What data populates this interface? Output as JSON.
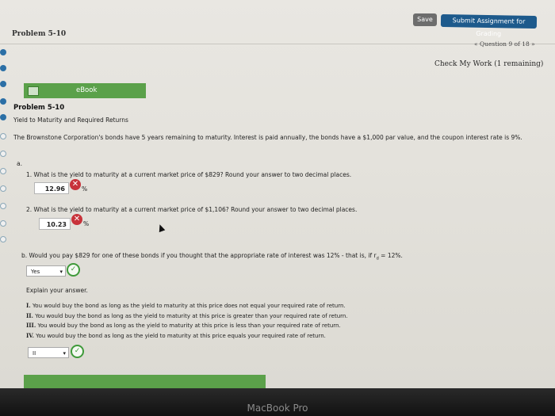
{
  "toolbar": {
    "save_label": "Save",
    "submit_label": "Submit Assignment for Grading"
  },
  "header": {
    "problem_label": "Problem 5-10",
    "question_nav": "« Question 9 of 18 »",
    "check_work": "Check My Work (1 remaining)"
  },
  "ebook": {
    "label": "eBook",
    "icon": "book-icon"
  },
  "problem": {
    "title": "Problem 5-10",
    "subtitle": "Yield to Maturity and Required Returns",
    "intro": "The Brownstone Corporation's bonds have 5 years remaining to maturity. Interest is paid annually, the bonds have a $1,000 par value, and the coupon interest rate is 9%."
  },
  "part_a": {
    "label": "a.",
    "q1": {
      "text": "1. What is the yield to maturity at a current market price of $829? Round your answer to two decimal places.",
      "answer": "12.96",
      "unit": "%",
      "status_icon": "x-circle-icon"
    },
    "q2": {
      "text": "2. What is the yield to maturity at a current market price of $1,106? Round your answer to two decimal places.",
      "answer": "10.23",
      "unit": "%",
      "status_icon": "x-circle-icon"
    }
  },
  "part_b": {
    "text": "b. Would you pay $829 for one of these bonds if you thought that the appropriate rate of interest was 12% - that is, if r",
    "subscript": "d",
    "text_end": " = 12%.",
    "select_value": "Yes",
    "explain_label": "Explain your answer.",
    "options": [
      {
        "num": "I.",
        "text": "You would buy the bond as long as the yield to maturity at this price does not equal your required rate of return."
      },
      {
        "num": "II.",
        "text": "You would buy the bond as long as the yield to maturity at this price is greater than your required rate of return."
      },
      {
        "num": "III.",
        "text": "You would buy the bond as long as the yield to maturity at this price is less than your required rate of return."
      },
      {
        "num": "IV.",
        "text": "You would buy the bond as long as the yield to maturity at this price equals your required rate of return."
      }
    ],
    "explain_select_value": "II"
  },
  "footer": {
    "brand": "MacBook Pro"
  },
  "colors": {
    "submit": "#1d5a8c",
    "ebook_green": "#5ba14a",
    "wrong_red": "#c8323a",
    "correct_green": "#3f9a3a"
  }
}
